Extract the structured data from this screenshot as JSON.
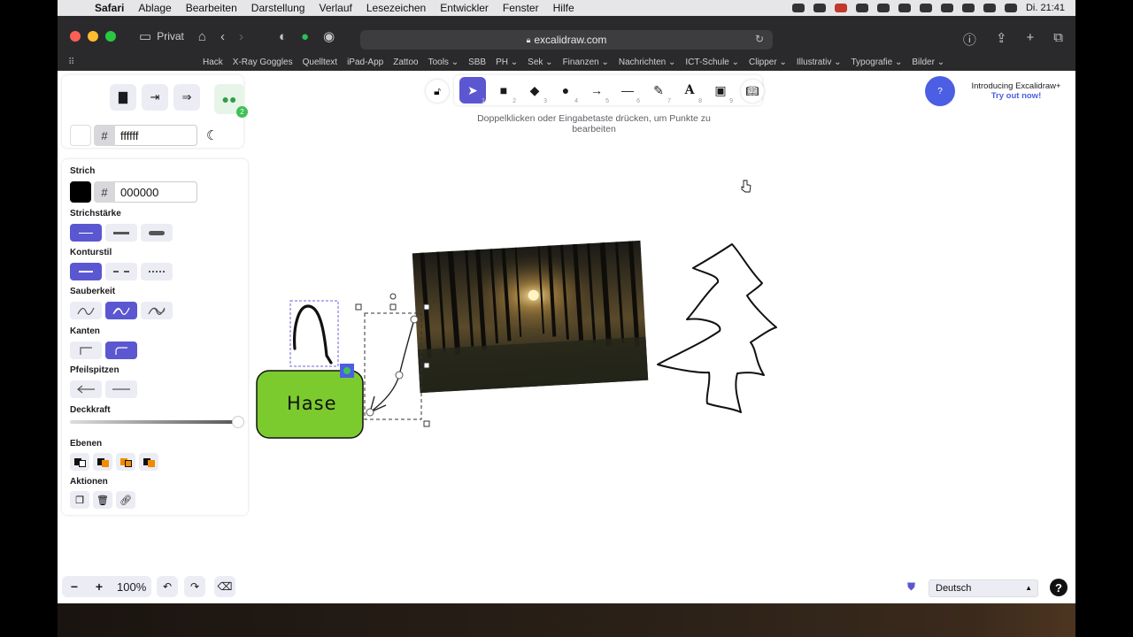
{
  "menubar": {
    "app": "Safari",
    "items": [
      "Ablage",
      "Bearbeiten",
      "Darstellung",
      "Verlauf",
      "Lesezeichen",
      "Entwickler",
      "Fenster",
      "Hilfe"
    ],
    "clock": "Di. 21:41"
  },
  "browser": {
    "private_label": "Privat",
    "url": "excalidraw.com",
    "favorites": [
      "Hack",
      "X-Ray Goggles",
      "Quelltext",
      "iPad-App",
      "Zattoo",
      "Tools ⌄",
      "SBB",
      "PH ⌄",
      "Sek ⌄",
      "Finanzen ⌄",
      "Nachrichten ⌄",
      "ICT-Schule ⌄",
      "Clipper ⌄",
      "Illustrativ ⌄",
      "Typografie ⌄",
      "Bilder ⌄"
    ]
  },
  "canvas_bg": {
    "hash": "#",
    "value": "ffffff"
  },
  "properties": {
    "stroke_label": "Strich",
    "stroke_hash": "#",
    "stroke_value": "000000",
    "stroke_width_label": "Strichstärke",
    "stroke_style_label": "Konturstil",
    "sloppiness_label": "Sauberkeit",
    "edges_label": "Kanten",
    "arrowheads_label": "Pfeilspitzen",
    "opacity_label": "Deckkraft",
    "opacity": 100,
    "layers_label": "Ebenen",
    "actions_label": "Aktionen"
  },
  "toolbar": {
    "tools": [
      {
        "name": "selection",
        "icon": "cursor-icon",
        "num": "1"
      },
      {
        "name": "rectangle",
        "icon": "square-icon",
        "num": "2"
      },
      {
        "name": "diamond",
        "icon": "diamond-icon",
        "num": "3"
      },
      {
        "name": "ellipse",
        "icon": "circle-icon",
        "num": "4"
      },
      {
        "name": "arrow",
        "icon": "arrow-icon",
        "num": "5"
      },
      {
        "name": "line",
        "icon": "line-icon",
        "num": "6"
      },
      {
        "name": "draw",
        "icon": "pencil-icon",
        "num": "7"
      },
      {
        "name": "text",
        "icon": "text-icon",
        "num": "8"
      },
      {
        "name": "image",
        "icon": "image-icon",
        "num": "9"
      }
    ],
    "hint": "Doppelklicken oder Eingabetaste drücken, um Punkte zu bearbeiten"
  },
  "promo": {
    "badge": "?",
    "line1": "Introducing Excalidraw+",
    "line2": "Try out now!"
  },
  "canvas": {
    "box_text": "Hase",
    "box_color": "#7bcb2e"
  },
  "footer": {
    "zoom": "100%",
    "minus": "−",
    "plus": "+",
    "language": "Deutsch",
    "help": "?"
  },
  "colors": {
    "accent": "#5b57d1",
    "promo_blue": "#4c5ee3"
  }
}
